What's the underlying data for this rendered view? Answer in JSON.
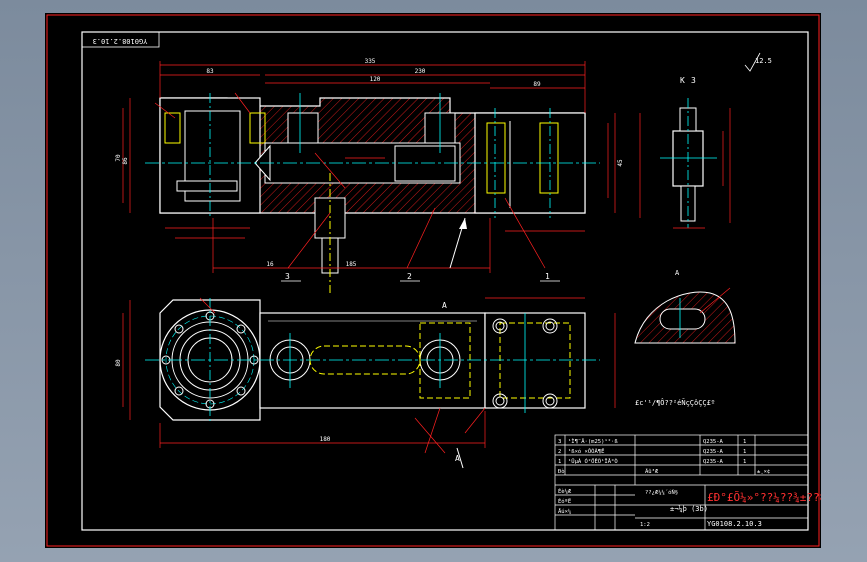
{
  "drawing": {
    "corner_code": "YG0108.2.10.3",
    "right_code": "YG0108.2.10.3",
    "view_label_k": "K",
    "view_label_a": "A",
    "view_label_a_bottom": "A",
    "roughness": "12.5",
    "callouts": [
      "3",
      "2",
      "1"
    ],
    "note_line": "£c'¹/¶Ô??²éÑçÇôÇÇ£º",
    "watermark": "£Ð°£Õ¼»°??¼??¾±??8¹§",
    "dims": {
      "overall_top": "335",
      "top_230": "230",
      "top_120": "120",
      "top_89": "89",
      "top_83": "83",
      "top_45": "45",
      "side_86": "86",
      "side_70": "70",
      "bottom_185": "185",
      "bottom_16": "16",
      "plan_180": "180",
      "plan_80": "80"
    },
    "title_block": {
      "rows": [
        {
          "no": "3",
          "text": "¹Ì¶¨Â·(m25)¹²·ß",
          "mat": "Q235-A",
          "qty": "1"
        },
        {
          "no": "2",
          "text": "¹ß×ó ×ÔÓÃ¶Ë",
          "mat": "Q235-A",
          "qty": "1"
        },
        {
          "no": "1",
          "text": "¹ÜµÀ Ó²ÖÊÕ¹ÏÂ°Ò",
          "mat": "Q235-A",
          "qty": "1"
        }
      ],
      "header_left": "Ðò",
      "header_mid": "Ãû³Æ",
      "header_right": "±¸×¢",
      "part_name": "±¬¼þ (3b)",
      "school": "??¿Æ¼¼´óÑ§",
      "drawing_no": "YG0108.2.10.3",
      "scale": "1:2",
      "design": "Éè¼Æ",
      "check": "ÉóºË",
      "approve": "Åú×¼"
    }
  }
}
